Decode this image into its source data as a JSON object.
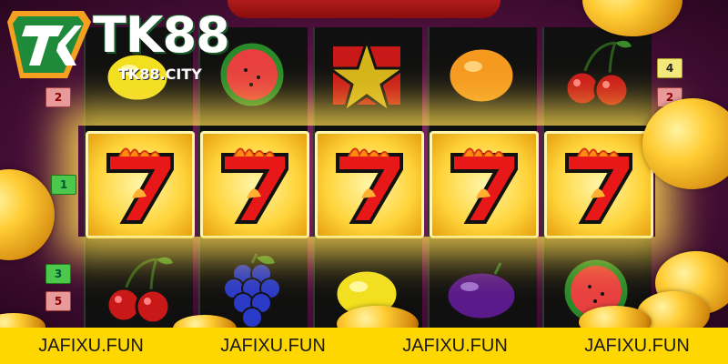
{
  "brand": {
    "logo_text": "TK88",
    "logo_sub": "TK88.CITY",
    "colors": {
      "green": "#1f8a3a",
      "orange": "#f5a020",
      "white": "#ffffff"
    }
  },
  "game": {
    "reels": [
      [
        "lemon",
        "seven",
        "cherry"
      ],
      [
        "watermelon",
        "seven",
        "grapes"
      ],
      [
        "star",
        "seven",
        "lemon"
      ],
      [
        "orange",
        "seven",
        "plum"
      ],
      [
        "cherry",
        "seven",
        "watermelon"
      ]
    ],
    "left_buttons": [
      {
        "label": "2",
        "style": "pink"
      },
      {
        "label": "1",
        "style": "green"
      },
      {
        "label": "3",
        "style": "green"
      },
      {
        "label": "5",
        "style": "pink"
      }
    ],
    "right_buttons": [
      {
        "label": "4",
        "style": "yellow"
      },
      {
        "label": "2",
        "style": "pink"
      }
    ]
  },
  "footer": {
    "items": [
      "JAFIXU.FUN",
      "JAFIXU.FUN",
      "JAFIXU.FUN",
      "JAFIXU.FUN"
    ],
    "background": "#ffd700"
  }
}
